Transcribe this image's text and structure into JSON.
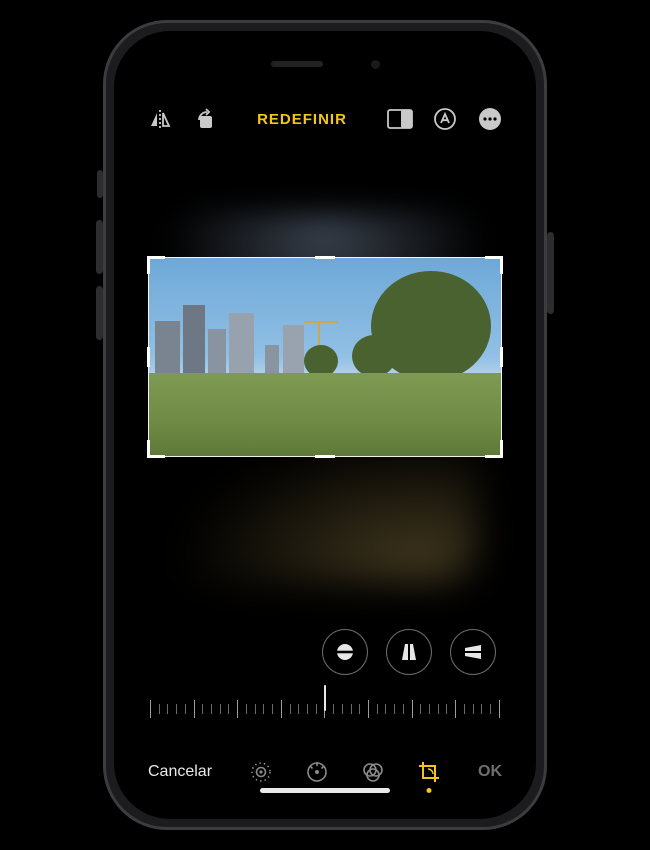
{
  "colors": {
    "accent": "#f5c518",
    "icon": "#c9c9c9",
    "dim": "#6f6f6f"
  },
  "topbar": {
    "flip_icon": "flip-horizontal-icon",
    "rotate_icon": "rotate-icon",
    "reset_label": "REDEFINIR",
    "aspect_icon": "aspect-ratio-icon",
    "markup_icon": "markup-icon",
    "more_icon": "more-icon"
  },
  "crop": {
    "adjustments": [
      {
        "id": "straighten",
        "icon": "straighten-icon"
      },
      {
        "id": "vertical",
        "icon": "perspective-vertical-icon"
      },
      {
        "id": "horizontal",
        "icon": "perspective-horizontal-icon"
      }
    ],
    "slider": {
      "value": 0,
      "min": -45,
      "max": 45,
      "tick_count": 41
    }
  },
  "bottombar": {
    "cancel_label": "Cancelar",
    "ok_label": "OK",
    "modes": [
      {
        "id": "live",
        "icon": "live-photo-icon",
        "active": false
      },
      {
        "id": "adjust",
        "icon": "adjust-icon",
        "active": false
      },
      {
        "id": "filters",
        "icon": "filters-icon",
        "active": false
      },
      {
        "id": "crop",
        "icon": "crop-icon",
        "active": true
      }
    ]
  }
}
